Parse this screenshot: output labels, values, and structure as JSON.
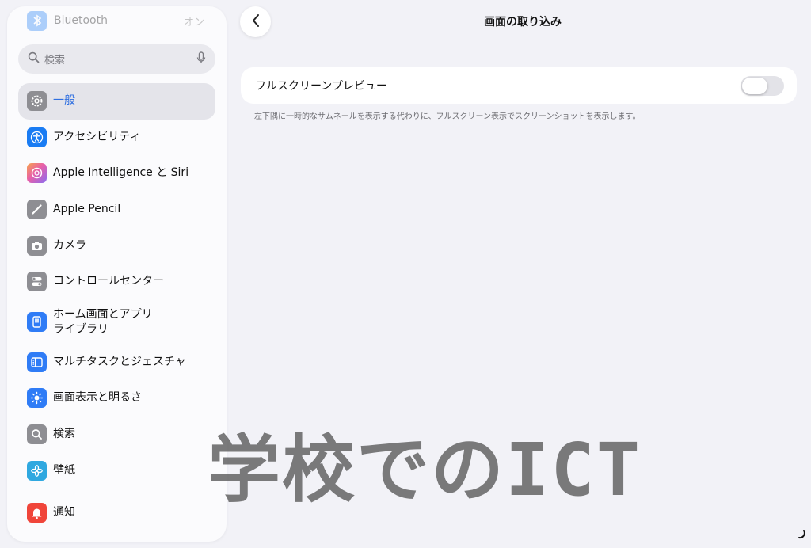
{
  "sidebar": {
    "bluetooth": {
      "label": "Bluetooth",
      "value": "オン"
    },
    "search": {
      "placeholder": "検索"
    },
    "items": [
      {
        "label": "一般",
        "icon": "gear-icon",
        "color": "#8e8e93",
        "selected": true
      },
      {
        "label": "アクセシビリティ",
        "icon": "accessibility-icon",
        "color": "#1a7cf3"
      },
      {
        "label": "Apple Intelligence と Siri",
        "icon": "apple-intelligence-icon",
        "color": "#c86bdc"
      },
      {
        "label": "Apple Pencil",
        "icon": "pencil-icon",
        "color": "#8e8e93"
      },
      {
        "label": "カメラ",
        "icon": "camera-icon",
        "color": "#8e8e93"
      },
      {
        "label": "コントロールセンター",
        "icon": "control-center-icon",
        "color": "#8e8e93"
      },
      {
        "label": "ホーム画面とアプリ\nライブラリ",
        "icon": "home-screen-icon",
        "color": "#2f7cf6"
      },
      {
        "label": "マルチタスクとジェスチャ",
        "icon": "multitasking-icon",
        "color": "#2f7cf6"
      },
      {
        "label": "画面表示と明るさ",
        "icon": "brightness-icon",
        "color": "#2f7cf6"
      },
      {
        "label": "検索",
        "icon": "search-icon",
        "color": "#8e8e93"
      },
      {
        "label": "壁紙",
        "icon": "wallpaper-icon",
        "color": "#2fa8e0"
      },
      {
        "label": "通知",
        "icon": "notification-icon",
        "color": "#f0453a"
      }
    ]
  },
  "main": {
    "title": "画面の取り込み",
    "setting": {
      "label": "フルスクリーンプレビュー",
      "enabled": false
    },
    "footnote": "左下隅に一時的なサムネールを表示する代わりに、フルスクリーン表示でスクリーンショットを表示します。"
  },
  "watermark": "学校でのICT",
  "colors": {
    "accent": "#2f6fe0",
    "background": "#f2f2f7",
    "card": "#ffffff"
  }
}
